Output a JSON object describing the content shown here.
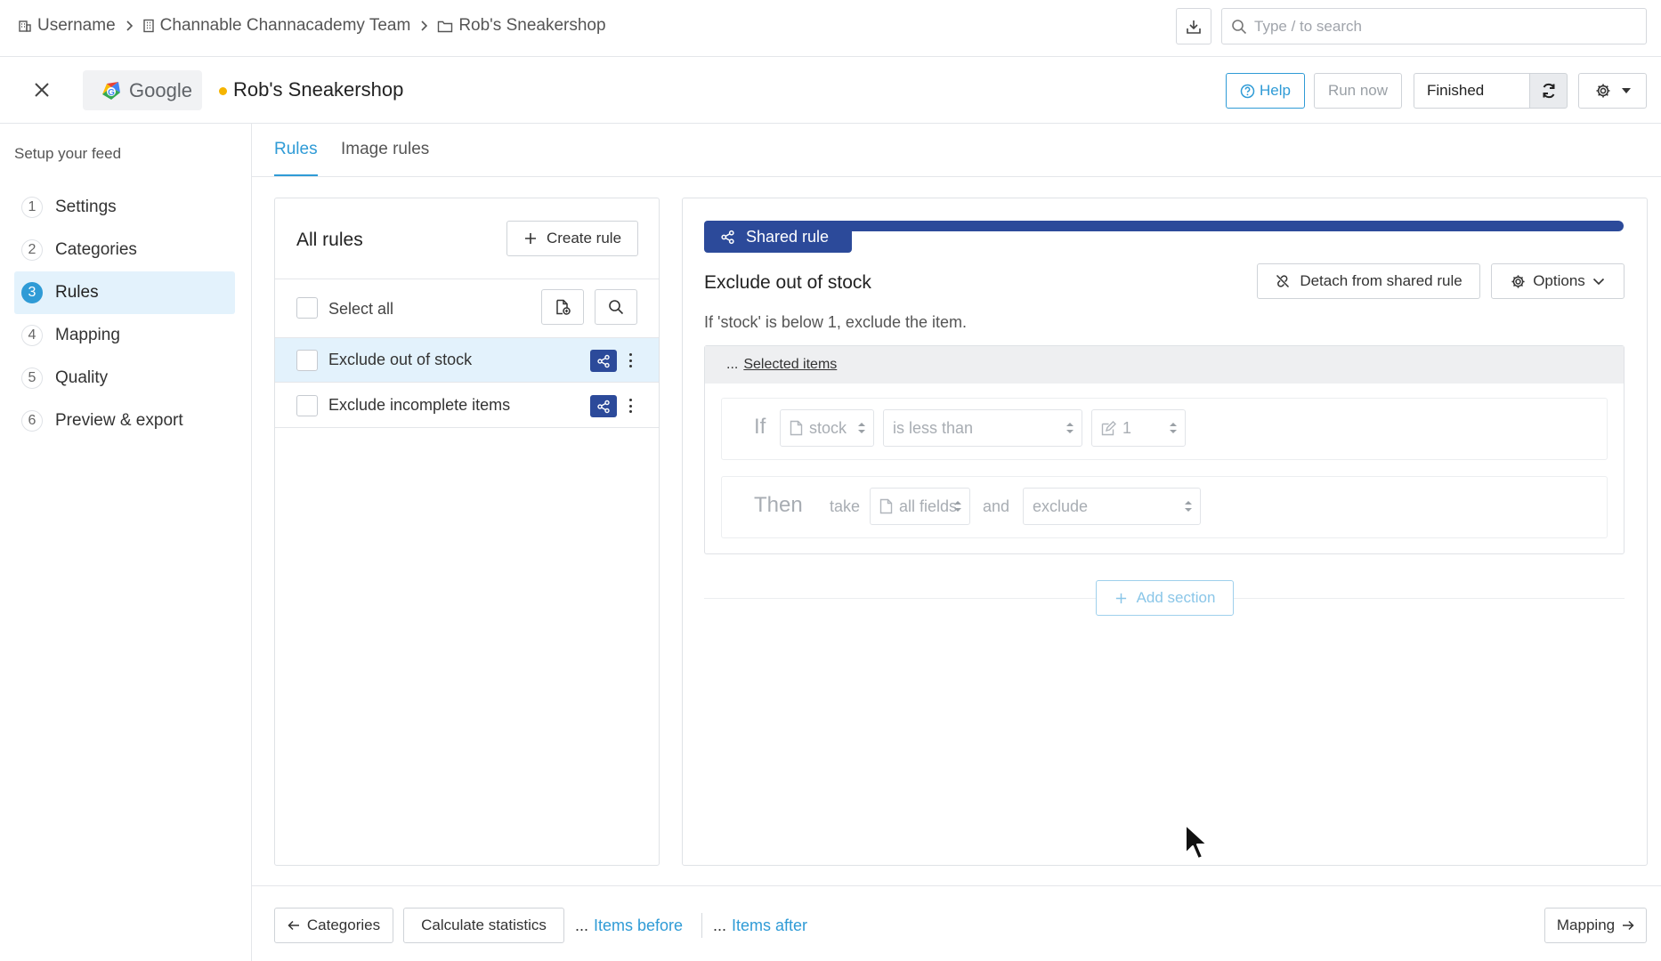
{
  "breadcrumb": {
    "user": "Username",
    "team": "Channable Channacademy Team",
    "project": "Rob's Sneakershop"
  },
  "search": {
    "placeholder": "Type / to search",
    "value": ""
  },
  "header": {
    "channel_name": "Google",
    "feed_title": "Rob's Sneakershop",
    "help_label": "Help",
    "run_now_label": "Run now",
    "status_label": "Finished"
  },
  "sidebar": {
    "heading": "Setup your feed",
    "steps": [
      {
        "num": "1",
        "label": "Settings"
      },
      {
        "num": "2",
        "label": "Categories"
      },
      {
        "num": "3",
        "label": "Rules"
      },
      {
        "num": "4",
        "label": "Mapping"
      },
      {
        "num": "5",
        "label": "Quality"
      },
      {
        "num": "6",
        "label": "Preview & export"
      }
    ],
    "active_step": 3
  },
  "tabs": [
    {
      "label": "Rules",
      "active": true
    },
    {
      "label": "Image rules",
      "active": false
    }
  ],
  "rules_list": {
    "title": "All rules",
    "create_label": "Create rule",
    "select_all_label": "Select all",
    "rules": [
      {
        "name": "Exclude out of stock",
        "selected": true,
        "shared": true
      },
      {
        "name": "Exclude incomplete items",
        "selected": false,
        "shared": true
      }
    ]
  },
  "rule_detail": {
    "shared_tag": "Shared rule",
    "title": "Exclude out of stock",
    "detach_label": "Detach from shared rule",
    "options_label": "Options",
    "description": "If 'stock' is below 1, exclude the item.",
    "section_prefix": "...",
    "section_label": "Selected items",
    "if_keyword": "If",
    "if_field": "stock",
    "if_operator": "is less than",
    "if_value": "1",
    "then_keyword": "Then",
    "take_word": "take",
    "then_field": "all fields",
    "and_word": "and",
    "then_action": "exclude",
    "add_section_label": "Add section"
  },
  "footer": {
    "back_label": "Categories",
    "calc_label": "Calculate statistics",
    "items_before_prefix": "...",
    "items_before_label": "Items before",
    "items_after_prefix": "...",
    "items_after_label": "Items after",
    "next_label": "Mapping"
  },
  "colors": {
    "accent": "#2f9bd6",
    "shared": "#2c4a9a",
    "active_bg": "#e3f2fc",
    "status_dot": "#f5b400"
  }
}
